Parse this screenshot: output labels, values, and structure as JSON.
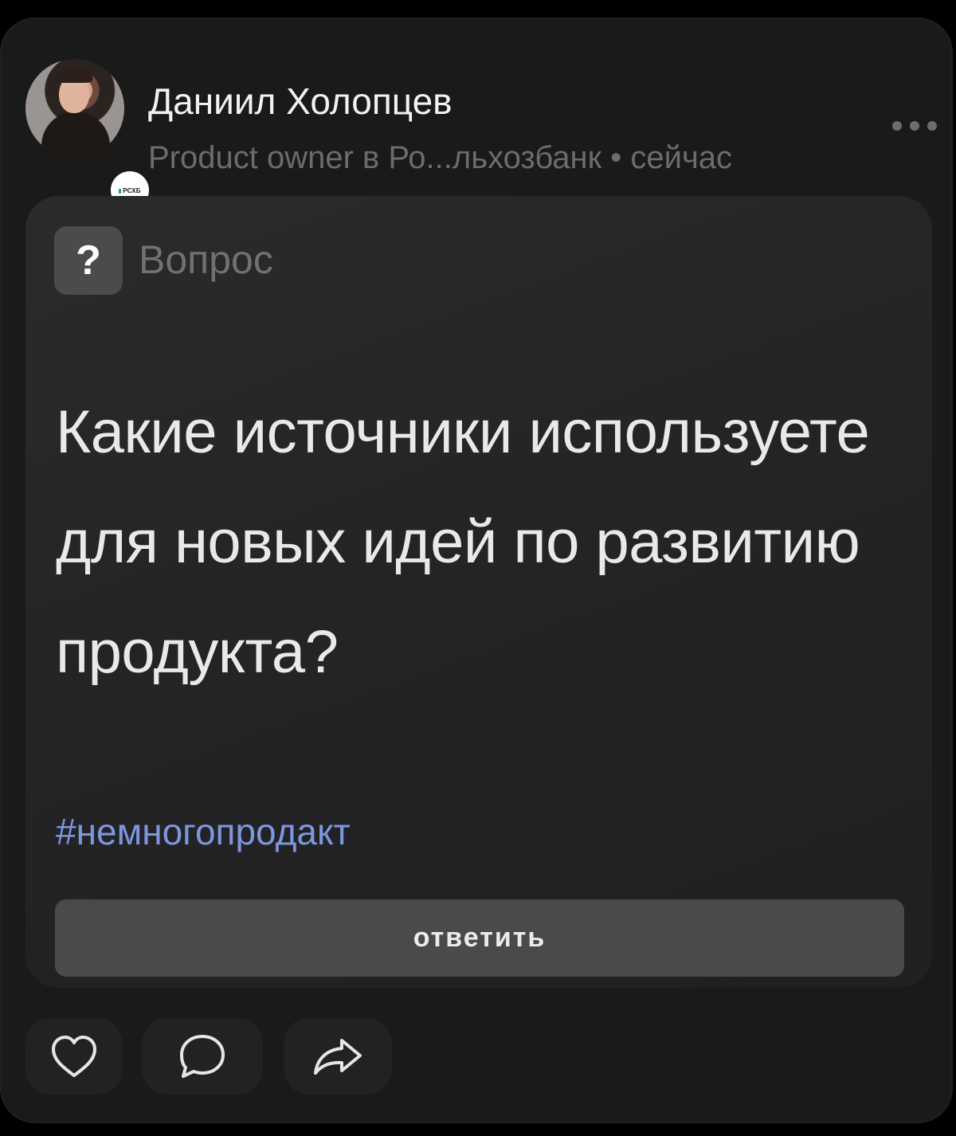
{
  "post": {
    "author": {
      "name": "Даниил Холопцев",
      "meta": "Product owner в Ро...льхозбанк • сейчас",
      "company_badge": "РСХБ"
    },
    "more_icon": "more-horizontal-icon",
    "question": {
      "badge_symbol": "?",
      "badge_label": "Вопрос",
      "text": "Какие источники используете для новых идей по развитию продукта?",
      "hashtag": "#немногопродакт",
      "answer_button": "ответить"
    },
    "actions": {
      "like_icon": "heart-icon",
      "comment_icon": "comment-icon",
      "share_icon": "share-icon"
    }
  },
  "colors": {
    "background": "#000000",
    "card": "#1a1a1b",
    "hashtag": "#7d97de",
    "button": "#4a4a4d"
  }
}
